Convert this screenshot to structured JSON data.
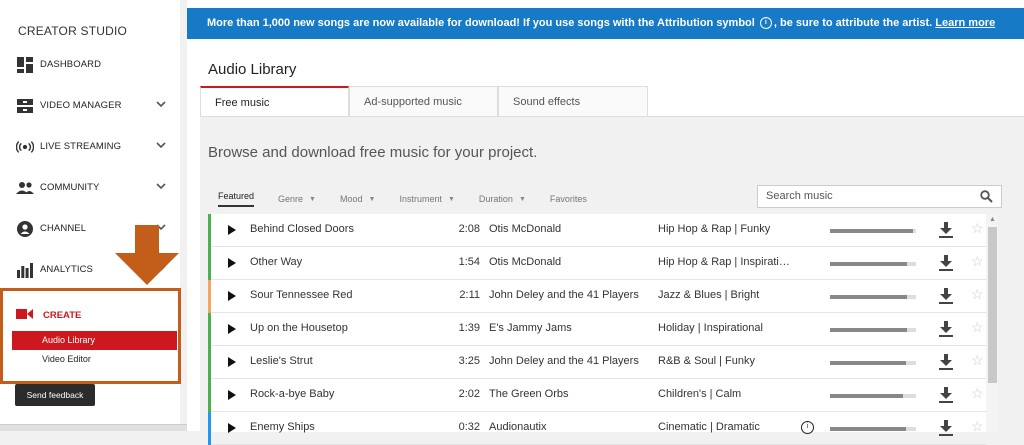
{
  "sidebar": {
    "title": "CREATOR STUDIO",
    "items": [
      {
        "label": "DASHBOARD",
        "icon": "dashboard-icon",
        "chevron": false
      },
      {
        "label": "VIDEO MANAGER",
        "icon": "video-manager-icon",
        "chevron": true
      },
      {
        "label": "LIVE STREAMING",
        "icon": "live-streaming-icon",
        "chevron": true
      },
      {
        "label": "COMMUNITY",
        "icon": "community-icon",
        "chevron": true
      },
      {
        "label": "CHANNEL",
        "icon": "channel-icon",
        "chevron": true
      },
      {
        "label": "ANALYTICS",
        "icon": "analytics-icon",
        "chevron": true
      }
    ],
    "create": {
      "label": "CREATE",
      "sub_items": [
        "Audio Library",
        "Video Editor"
      ],
      "active": "Audio Library"
    },
    "feedback_label": "Send feedback"
  },
  "banner": {
    "text_before": "More than 1,000 new songs are now available for download! If you use songs with the Attribution symbol",
    "text_after": ", be sure to attribute the artist.",
    "link": "Learn more"
  },
  "page_title": "Audio Library",
  "tabs": [
    "Free music",
    "Ad-supported music",
    "Sound effects"
  ],
  "active_tab": "Free music",
  "browse_text": "Browse and download free music for your project.",
  "filters": [
    {
      "label": "Featured",
      "active": true,
      "dropdown": false
    },
    {
      "label": "Genre",
      "active": false,
      "dropdown": true
    },
    {
      "label": "Mood",
      "active": false,
      "dropdown": true
    },
    {
      "label": "Instrument",
      "active": false,
      "dropdown": true
    },
    {
      "label": "Duration",
      "active": false,
      "dropdown": true
    },
    {
      "label": "Favorites",
      "active": false,
      "dropdown": false
    }
  ],
  "search": {
    "placeholder": "Search music"
  },
  "tracks": [
    {
      "title": "Behind Closed Doors",
      "duration": "2:08",
      "artist": "Otis McDonald",
      "genre": "Hip Hop & Rap | Funky",
      "attribution": false,
      "popularity": 0.97,
      "accent": "#4caf50"
    },
    {
      "title": "Other Way",
      "duration": "1:54",
      "artist": "Otis McDonald",
      "genre": "Hip Hop & Rap | Inspirati…",
      "attribution": false,
      "popularity": 0.9,
      "accent": "#4caf50"
    },
    {
      "title": "Sour Tennessee Red",
      "duration": "2:11",
      "artist": "John Deley and the 41 Players",
      "genre": "Jazz & Blues | Bright",
      "attribution": false,
      "popularity": 0.9,
      "accent": "#f4a460"
    },
    {
      "title": "Up on the Housetop",
      "duration": "1:39",
      "artist": "E's Jammy Jams",
      "genre": "Holiday | Inspirational",
      "attribution": false,
      "popularity": 0.9,
      "accent": "#4caf50"
    },
    {
      "title": "Leslie's Strut",
      "duration": "3:25",
      "artist": "John Deley and the 41 Players",
      "genre": "R&B & Soul | Funky",
      "attribution": false,
      "popularity": 0.88,
      "accent": "#4caf50"
    },
    {
      "title": "Rock-a-bye Baby",
      "duration": "2:02",
      "artist": "The Green Orbs",
      "genre": "Children's | Calm",
      "attribution": false,
      "popularity": 0.85,
      "accent": "#4caf50"
    },
    {
      "title": "Enemy Ships",
      "duration": "0:32",
      "artist": "Audionautix",
      "genre": "Cinematic | Dramatic",
      "attribution": true,
      "popularity": 0.88,
      "accent": "#2196f3"
    }
  ],
  "colors": {
    "banner": "#167ac6",
    "accent_red": "#cc181e",
    "highlight_orange": "#c25e1a"
  }
}
